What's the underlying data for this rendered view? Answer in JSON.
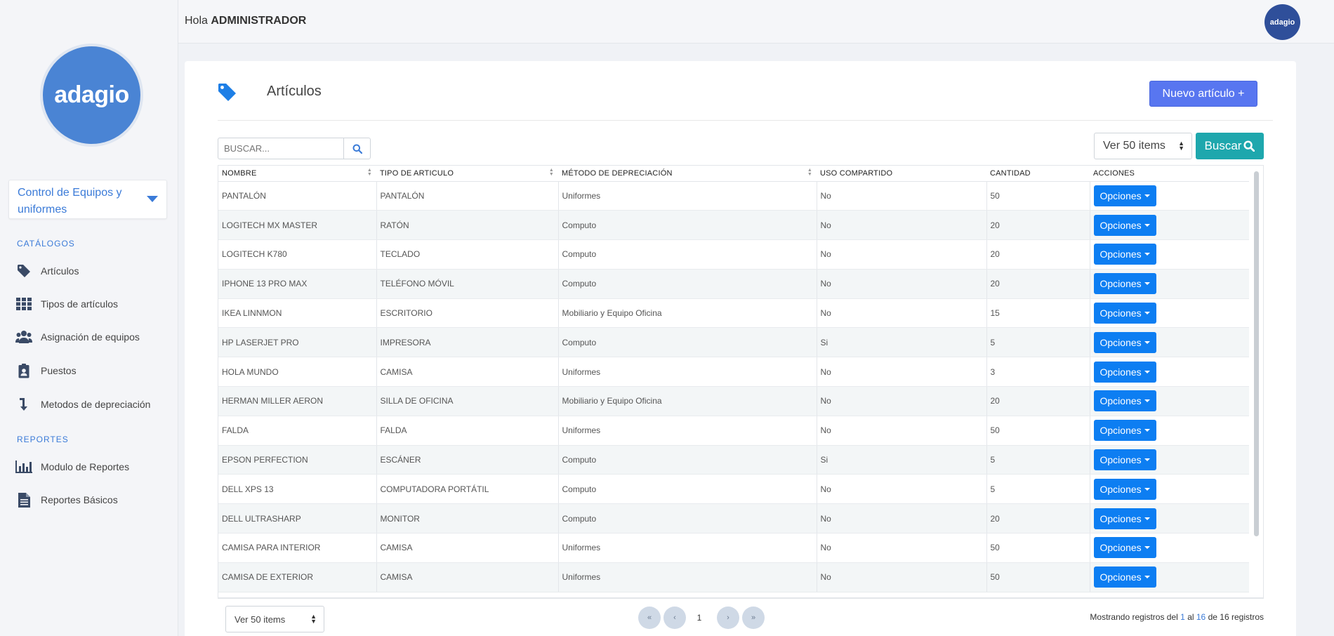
{
  "sidebar": {
    "logo_text": "adagio",
    "module_label": "Control de Equipos y uniformes",
    "sections": [
      {
        "title": "CATÁLOGOS",
        "items": [
          {
            "label": "Artículos",
            "icon": "tag-icon"
          },
          {
            "label": "Tipos de artículos",
            "icon": "grid-icon"
          },
          {
            "label": "Asignación de equipos",
            "icon": "users-icon"
          },
          {
            "label": "Puestos",
            "icon": "badge-icon"
          },
          {
            "label": "Metodos de depreciación",
            "icon": "level-down-icon"
          }
        ]
      },
      {
        "title": "REPORTES",
        "items": [
          {
            "label": "Modulo de Reportes",
            "icon": "bar-chart-icon"
          },
          {
            "label": "Reportes Básicos",
            "icon": "file-icon"
          }
        ]
      }
    ]
  },
  "topbar": {
    "greeting_prefix": "Hola",
    "user_name": "ADMINISTRADOR",
    "avatar_text": "adagio"
  },
  "page": {
    "title": "Artículos",
    "new_button": "Nuevo artículo +",
    "search_placeholder": "BUSCAR...",
    "per_page_top": "Ver 50 items",
    "buscar_button": "Buscar",
    "per_page_bottom": "Ver 50 items"
  },
  "table": {
    "columns": [
      "NOMBRE",
      "TIPO DE ARTICULO",
      "MÉTODO DE DEPRECIACIÓN",
      "USO COMPARTIDO",
      "CANTIDAD",
      "ACCIONES"
    ],
    "options_label": "Opciones",
    "rows": [
      [
        "PANTALÓN",
        "PANTALÓN",
        "Uniformes",
        "No",
        "50"
      ],
      [
        "LOGITECH MX MASTER",
        "RATÓN",
        "Computo",
        "No",
        "20"
      ],
      [
        "LOGITECH K780",
        "TECLADO",
        "Computo",
        "No",
        "20"
      ],
      [
        "IPHONE 13 PRO MAX",
        "TELÉFONO MÓVIL",
        "Computo",
        "No",
        "20"
      ],
      [
        "IKEA LINNMON",
        "ESCRITORIO",
        "Mobiliario y Equipo Oficina",
        "No",
        "15"
      ],
      [
        "HP LASERJET PRO",
        "IMPRESORA",
        "Computo",
        "Si",
        "5"
      ],
      [
        "HOLA MUNDO",
        "CAMISA",
        "Uniformes",
        "No",
        "3"
      ],
      [
        "HERMAN MILLER AERON",
        "SILLA DE OFICINA",
        "Mobiliario y Equipo Oficina",
        "No",
        "20"
      ],
      [
        "FALDA",
        "FALDA",
        "Uniformes",
        "No",
        "50"
      ],
      [
        "EPSON PERFECTION",
        "ESCÁNER",
        "Computo",
        "Si",
        "5"
      ],
      [
        "DELL XPS 13",
        "COMPUTADORA PORTÁTIL",
        "Computo",
        "No",
        "5"
      ],
      [
        "DELL ULTRASHARP",
        "MONITOR",
        "Computo",
        "No",
        "20"
      ],
      [
        "CAMISA PARA INTERIOR",
        "CAMISA",
        "Uniformes",
        "No",
        "50"
      ],
      [
        "CAMISA DE EXTERIOR",
        "CAMISA",
        "Uniformes",
        "No",
        "50"
      ]
    ]
  },
  "pagination": {
    "first": "«",
    "prev": "‹",
    "current": "1",
    "next": "›",
    "last": "»",
    "records_prefix": "Mostrando registros del",
    "from": "1",
    "to_word": "al",
    "to": "16",
    "of_word": "de",
    "total": "16",
    "suffix": "registros"
  },
  "colors": {
    "accent": "#3b7bd8",
    "new_button": "#5876f0",
    "buscar": "#1ea7ad",
    "options": "#0d7ef2"
  }
}
